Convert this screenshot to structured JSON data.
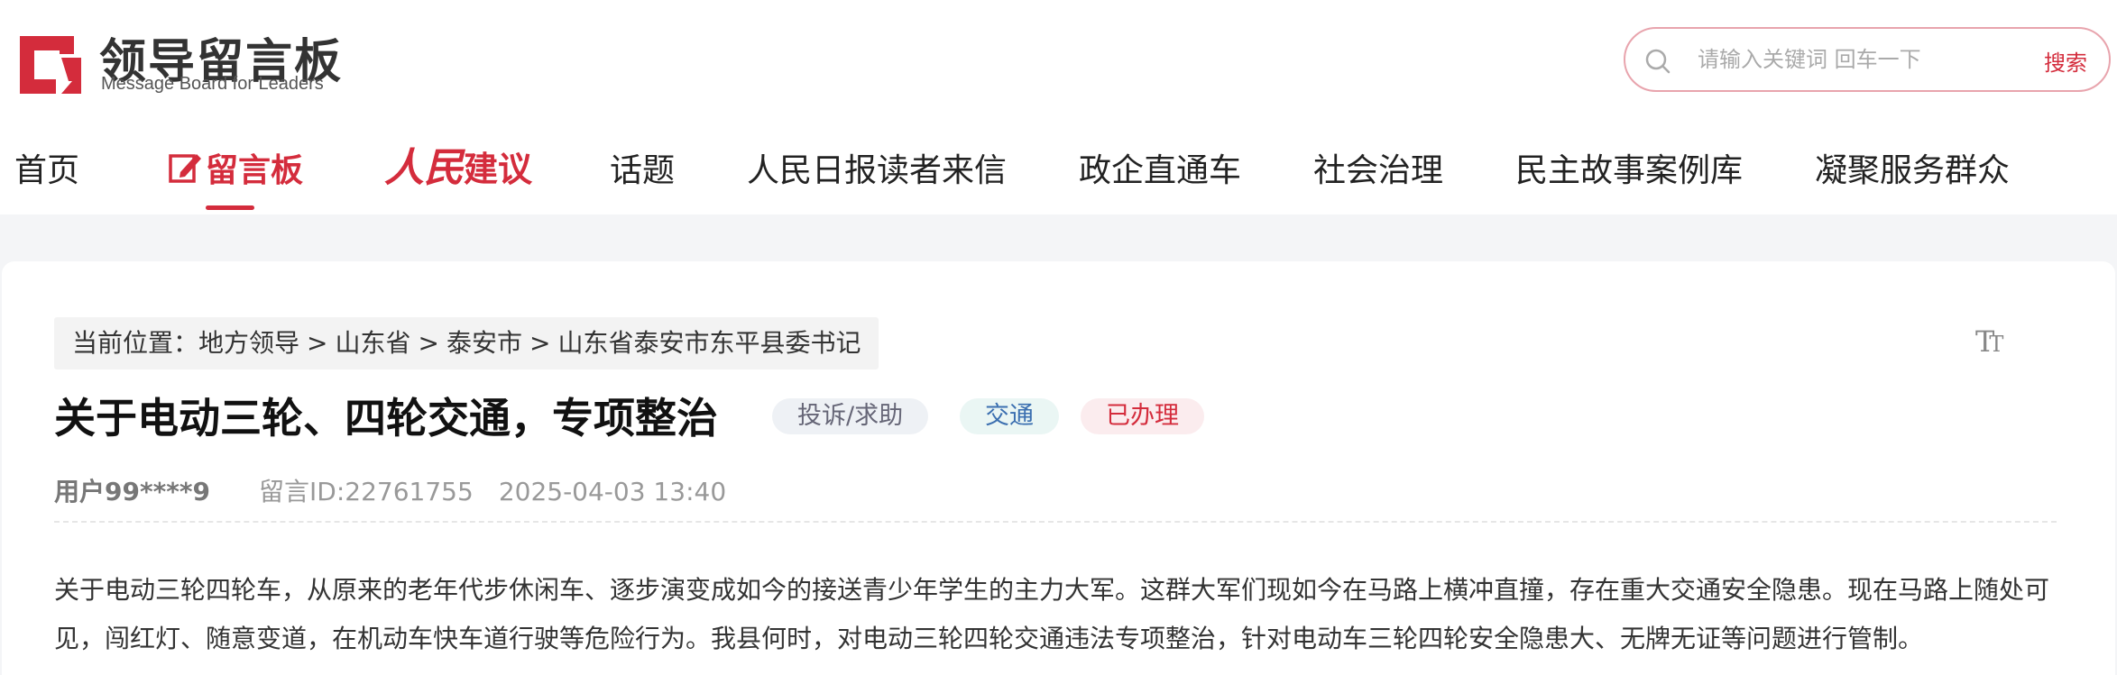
{
  "brand": {
    "name_cn": "领导留言板",
    "name_en": "Message Board for Leaders",
    "accent_color": "#d42c3c"
  },
  "search": {
    "placeholder": "请输入关键词 回车一下",
    "button_label": "搜索",
    "icon": "search-icon"
  },
  "nav": {
    "items": [
      {
        "label": "首页"
      },
      {
        "label": "留言板",
        "active": true,
        "icon": "edit-icon"
      },
      {
        "label_a": "人民",
        "label_b": "建议"
      },
      {
        "label": "话题"
      },
      {
        "label": "人民日报读者来信"
      },
      {
        "label": "政企直通车"
      },
      {
        "label": "社会治理"
      },
      {
        "label": "民主故事案例库"
      },
      {
        "label": "凝聚服务群众"
      }
    ]
  },
  "breadcrumb": {
    "prefix": "当前位置：",
    "items": [
      "地方领导",
      "山东省",
      "泰安市",
      "山东省泰安市东平县委书记"
    ],
    "separator": ">"
  },
  "font_toggle": {
    "big": "T",
    "small": "T",
    "icon": "font-size-icon"
  },
  "message": {
    "title": "关于电动三轮、四轮交通，专项整治",
    "tags": {
      "type": "投诉/求助",
      "field": "交通",
      "status": "已办理"
    },
    "user": "用户99****9",
    "id_label": "留言ID:22761755",
    "datetime": "2025-04-03 13:40",
    "body": "关于电动三轮四轮车，从原来的老年代步休闲车、逐步演变成如今的接送青少年学生的主力大军。这群大军们现如今在马路上横冲直撞，存在重大交通安全隐患。现在马路上随处可见，闯红灯、随意变道，在机动车快车道行驶等危险行为。我县何时，对电动三轮四轮交通违法专项整治，针对电动车三轮四轮安全隐患大、无牌无证等问题进行管制。"
  }
}
